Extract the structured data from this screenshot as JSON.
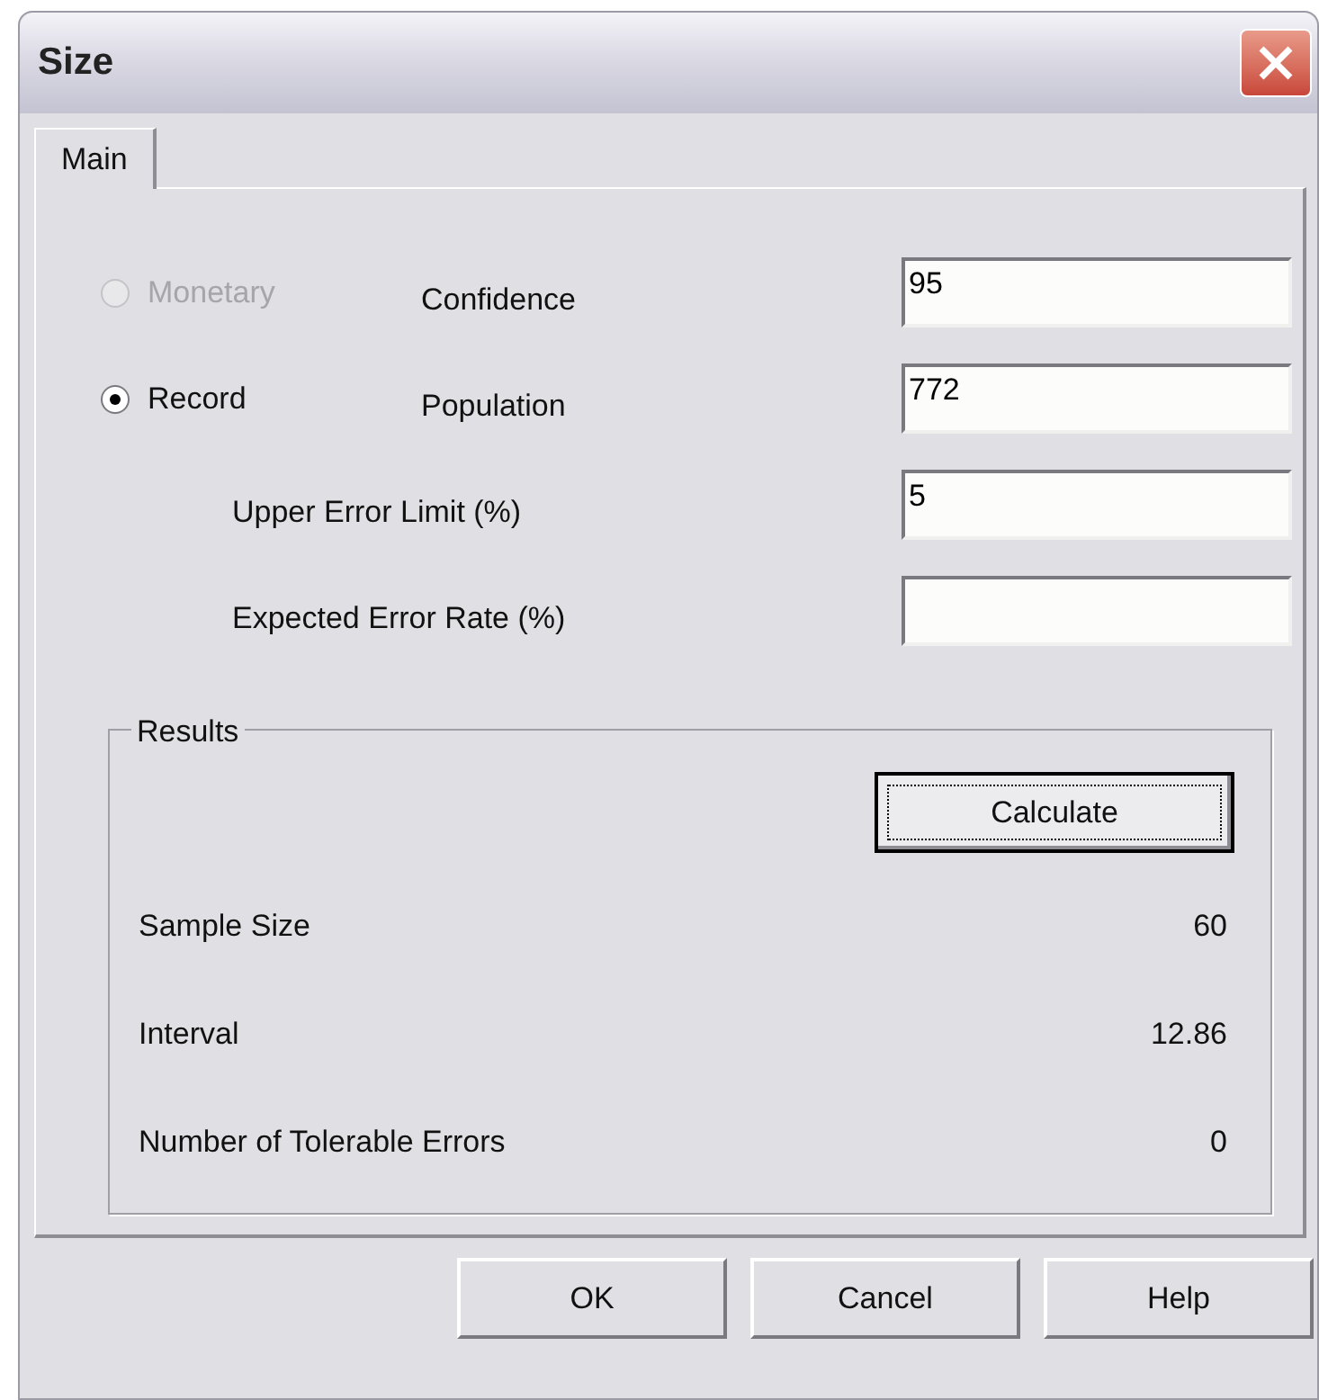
{
  "window": {
    "title": "Size"
  },
  "tabs": [
    {
      "label": "Main",
      "selected": true
    }
  ],
  "options": [
    {
      "label": "Monetary",
      "selected": false,
      "disabled": true
    },
    {
      "label": "Record",
      "selected": true,
      "disabled": false
    }
  ],
  "fields": [
    {
      "label": "Confidence",
      "value": "95"
    },
    {
      "label": "Population",
      "value": "772"
    },
    {
      "label": "Upper Error Limit (%)",
      "value": "5"
    },
    {
      "label": "Expected Error Rate (%)"
    }
  ],
  "results": {
    "title": "Results",
    "button": "Calculate",
    "rows": [
      {
        "label": "Sample Size",
        "value": "60"
      },
      {
        "label": "Interval",
        "value": "12.86"
      },
      {
        "label": "Number of Tolerable Errors",
        "value": "0"
      }
    ]
  },
  "buttons": [
    "OK",
    "Cancel",
    "Help"
  ]
}
